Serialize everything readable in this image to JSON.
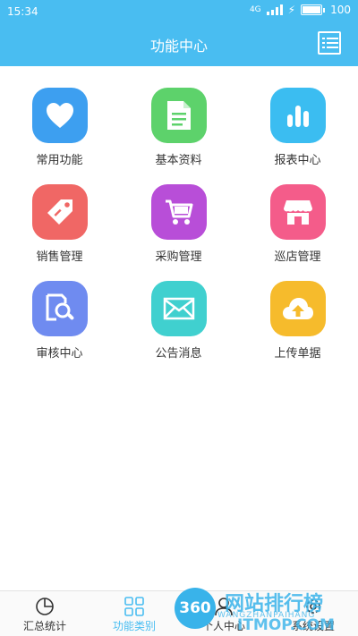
{
  "status": {
    "time": "15:34",
    "battery": "100",
    "network": "4G"
  },
  "header": {
    "title": "功能中心",
    "menu_icon": "list-icon",
    "bg_color": "#49bdf1"
  },
  "grid": [
    {
      "label": "常用功能",
      "icon": "heart-icon",
      "color": "#3d9ff0"
    },
    {
      "label": "基本资料",
      "icon": "document-icon",
      "color": "#5dd26b"
    },
    {
      "label": "报表中心",
      "icon": "bar-chart-icon",
      "color": "#3bbdf1"
    },
    {
      "label": "销售管理",
      "icon": "tag-icon",
      "color": "#f06765"
    },
    {
      "label": "采购管理",
      "icon": "cart-icon",
      "color": "#b84ed8"
    },
    {
      "label": "巡店管理",
      "icon": "store-icon",
      "color": "#f45c8a"
    },
    {
      "label": "审核中心",
      "icon": "magnify-doc-icon",
      "color": "#6f8bf0"
    },
    {
      "label": "公告消息",
      "icon": "mail-icon",
      "color": "#40d0cf"
    },
    {
      "label": "上传单据",
      "icon": "cloud-upload-icon",
      "color": "#f6bb2c"
    }
  ],
  "tabs": [
    {
      "label": "汇总统计",
      "icon": "pie-chart-icon"
    },
    {
      "label": "功能类别",
      "icon": "grid-icon",
      "active": true
    },
    {
      "label": "个人中心",
      "icon": "person-icon"
    },
    {
      "label": "系统设置",
      "icon": "gear-icon"
    }
  ],
  "watermark": {
    "badge": "360",
    "name": "网站排行榜",
    "pinyin": "WANGZHANPAIHANG",
    "domain": "ITMOP.COM"
  }
}
